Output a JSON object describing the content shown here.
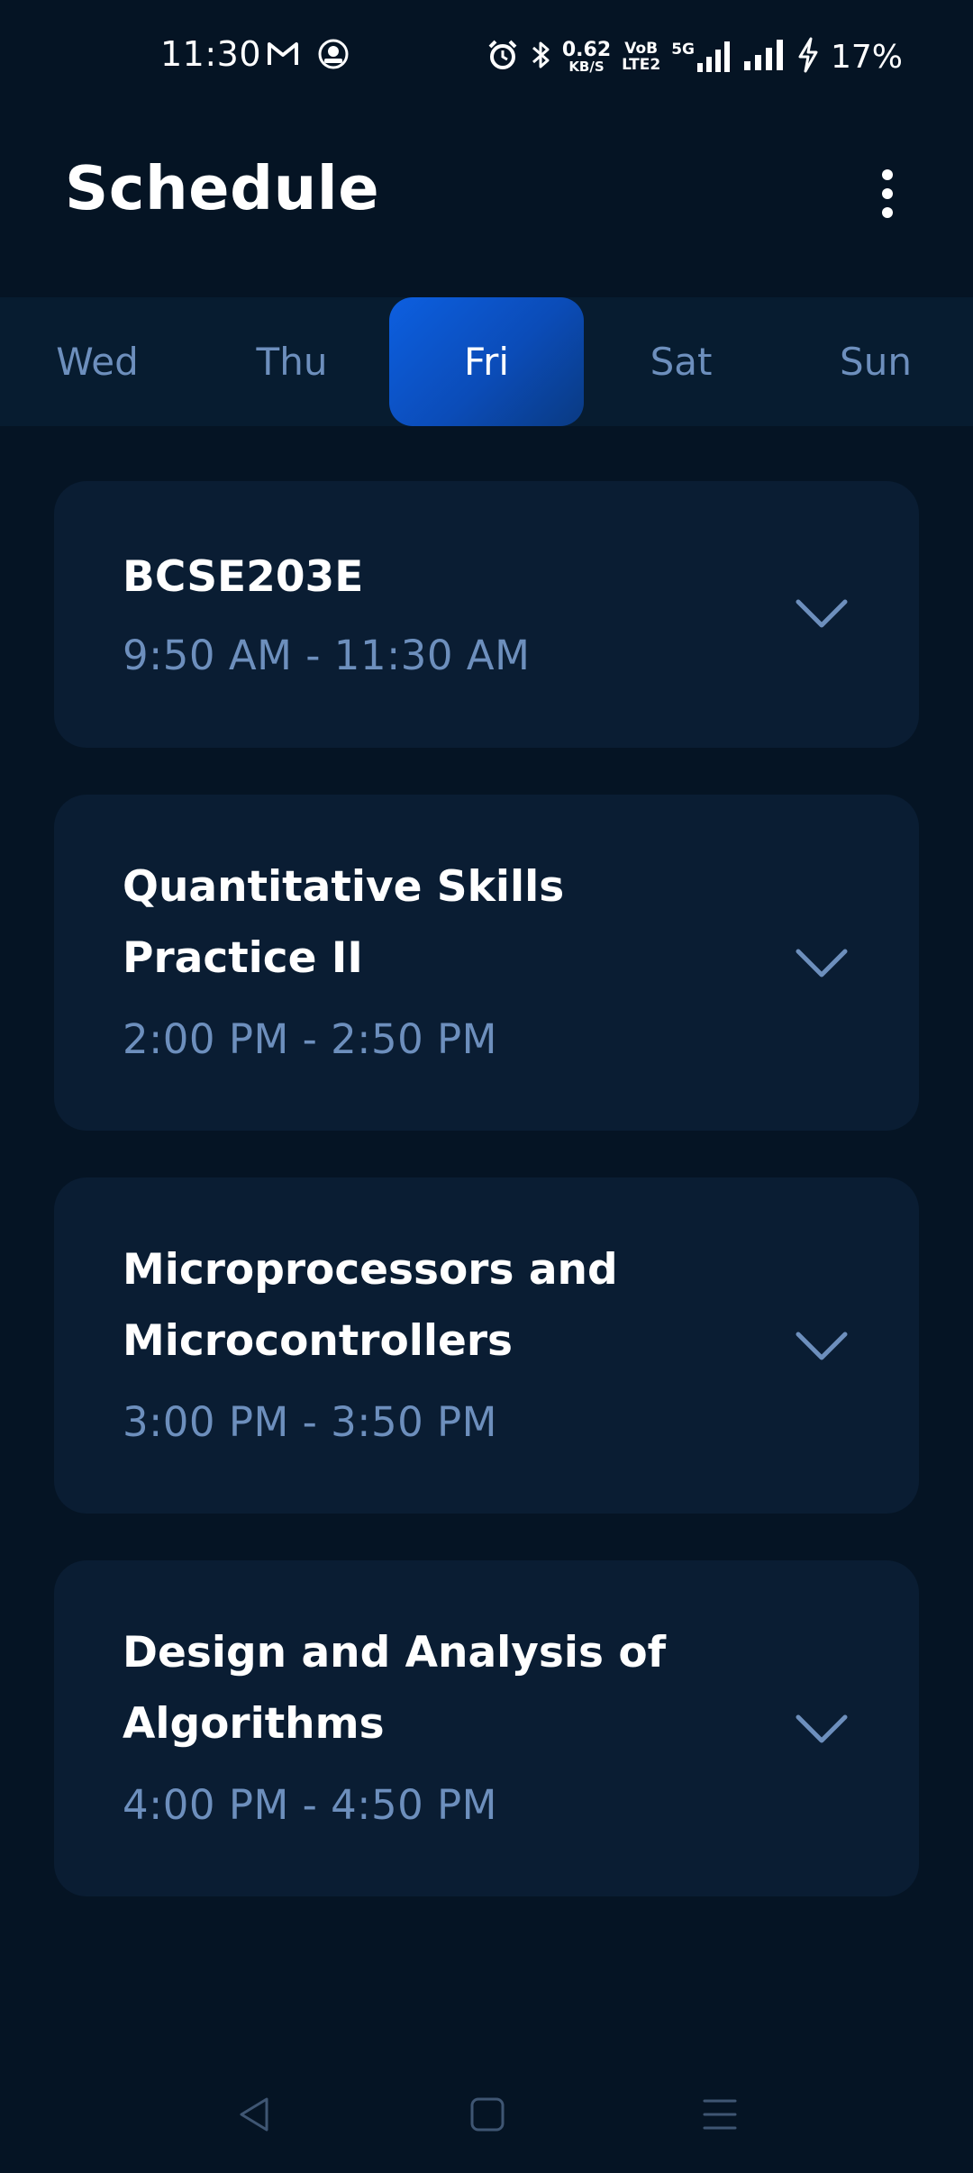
{
  "status_bar": {
    "time": "11:30",
    "speed_value": "0.62",
    "speed_unit": "KB/S",
    "volte_top": "VoB",
    "volte_bottom": "LTE2",
    "network": "5G",
    "battery": "17%"
  },
  "header": {
    "title": "Schedule"
  },
  "days": [
    {
      "label": "Wed",
      "active": false
    },
    {
      "label": "Thu",
      "active": false
    },
    {
      "label": "Fri",
      "active": true
    },
    {
      "label": "Sat",
      "active": false
    },
    {
      "label": "Sun",
      "active": false
    }
  ],
  "classes": [
    {
      "title": "BCSE203E",
      "time": "9:50 AM - 11:30 AM"
    },
    {
      "title": "Quantitative Skills Practice II",
      "time": "2:00 PM - 2:50 PM"
    },
    {
      "title": "Microprocessors and Microcontrollers",
      "time": "3:00 PM - 3:50 PM"
    },
    {
      "title": "Design and Analysis of Algorithms",
      "time": "4:00 PM - 4:50 PM"
    }
  ],
  "icons": {
    "gmail": "gmail-icon",
    "app": "app-notification-icon",
    "alarm": "alarm-icon",
    "bluetooth": "bluetooth-icon",
    "signal": "signal-icon",
    "charging": "charging-icon",
    "more": "more-vertical-icon",
    "expand": "chevron-down-icon",
    "back": "back-nav-icon",
    "home": "home-nav-icon",
    "recents": "recents-nav-icon"
  },
  "colors": {
    "background": "#051424",
    "card": "#0a1d33",
    "accent": "#0d5fe0",
    "muted_text": "#6d8fbd"
  }
}
